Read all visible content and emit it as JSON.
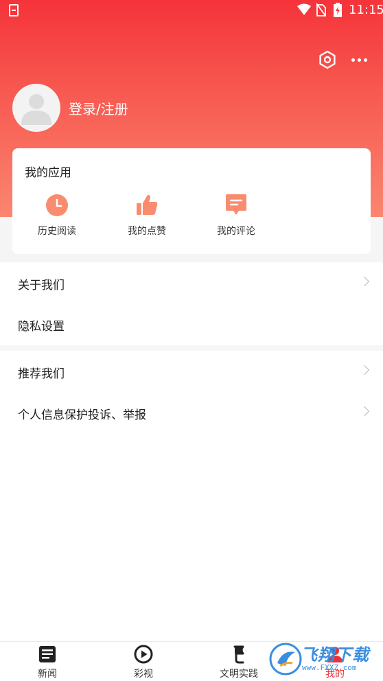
{
  "status_bar": {
    "time": "11:15"
  },
  "header": {
    "login_label": "登录/注册"
  },
  "apps": {
    "title": "我的应用",
    "items": [
      {
        "label": "历史阅读",
        "icon": "clock-icon"
      },
      {
        "label": "我的点赞",
        "icon": "thumbs-up-icon"
      },
      {
        "label": "我的评论",
        "icon": "comment-icon"
      }
    ]
  },
  "menu": {
    "group1": [
      {
        "label": "关于我们",
        "chevron": true
      },
      {
        "label": "隐私设置",
        "chevron": false
      }
    ],
    "group2": [
      {
        "label": "推荐我们",
        "chevron": true
      },
      {
        "label": "个人信息保护投诉、举报",
        "chevron": true
      }
    ]
  },
  "bottom_nav": {
    "items": [
      {
        "label": "新闻",
        "icon": "news-icon"
      },
      {
        "label": "彩视",
        "icon": "play-icon"
      },
      {
        "label": "文明实践",
        "icon": "flag-icon"
      },
      {
        "label": "我的",
        "icon": "profile-icon",
        "active": true
      }
    ]
  },
  "watermark": {
    "text": "飞翔下载",
    "url": "www.FXXZ.com"
  },
  "colors": {
    "accent": "#e8313a",
    "header_top": "#f5333a",
    "header_bottom": "#fb8670",
    "icon_salmon": "#f98c6f"
  }
}
